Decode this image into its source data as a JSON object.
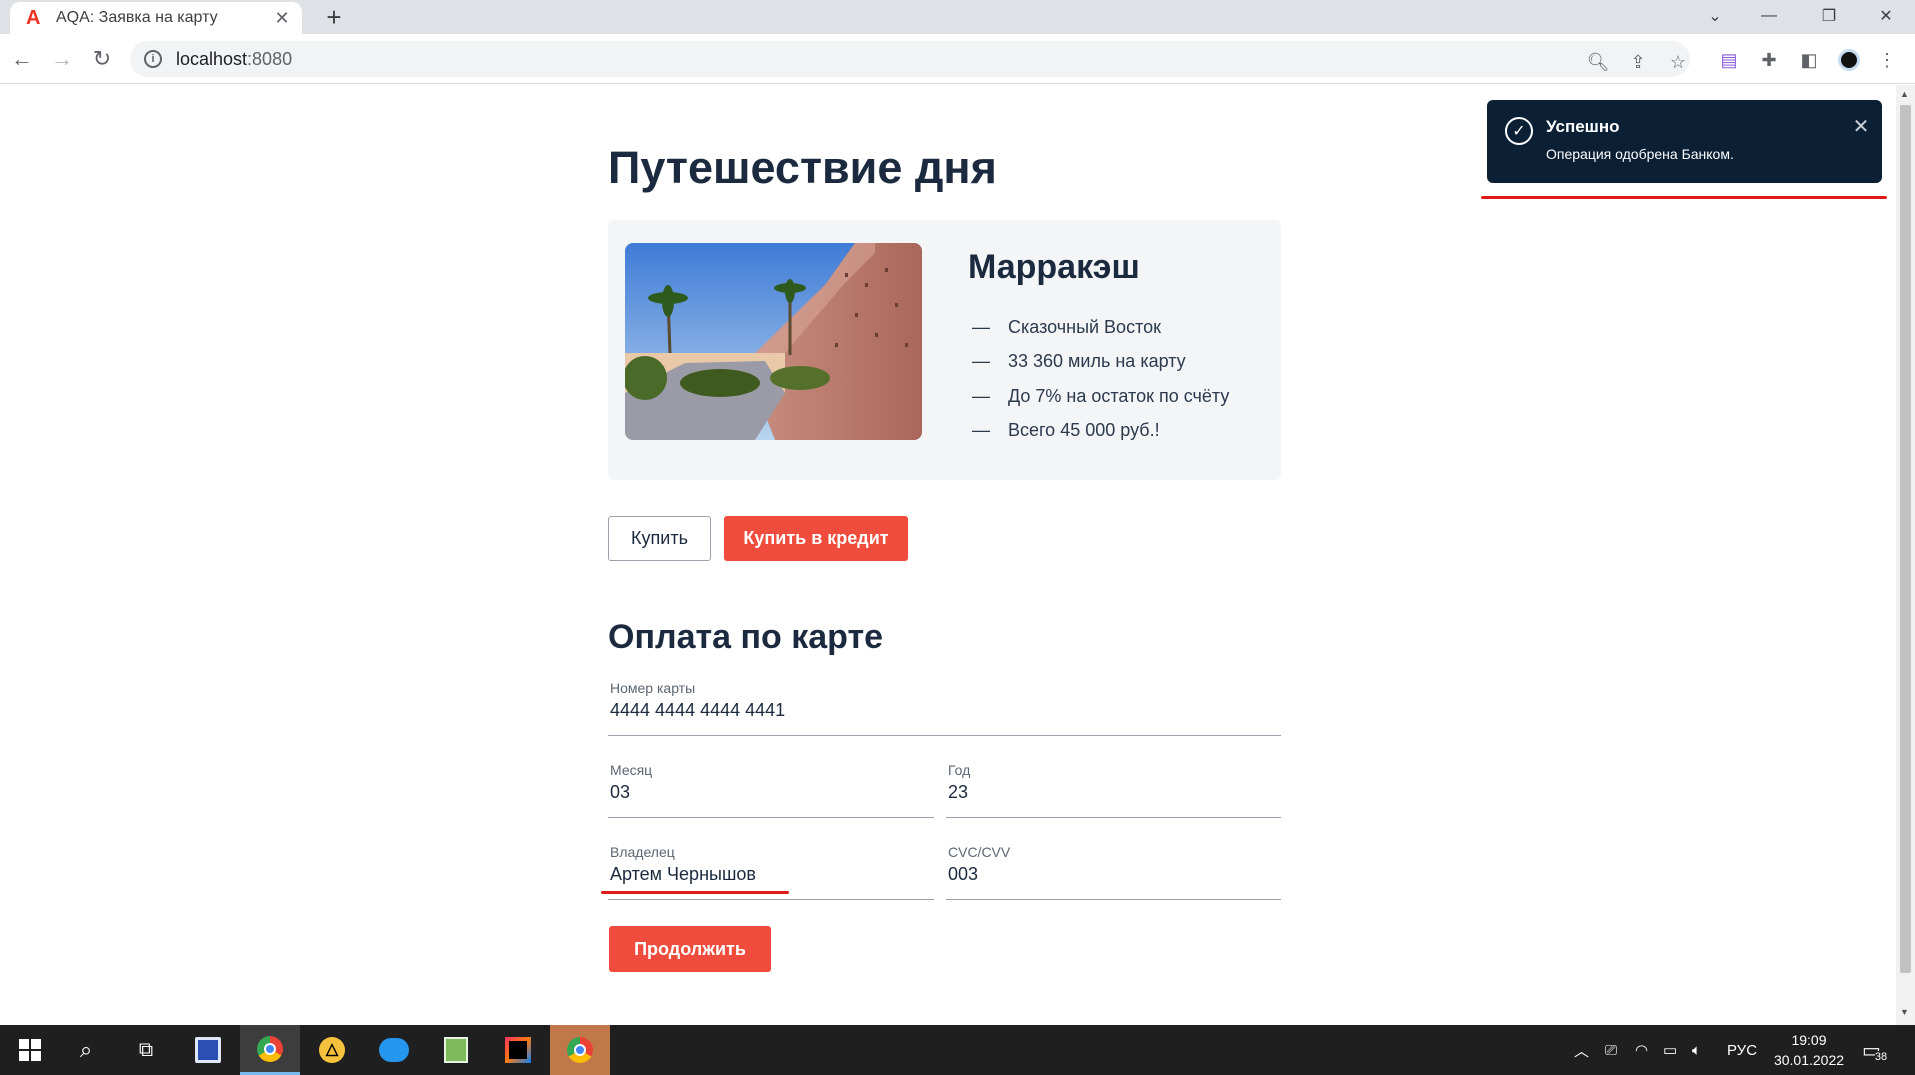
{
  "browser": {
    "tab_title": "AQA: Заявка на карту",
    "tab_favicon": "alfa-logo-icon",
    "url_host": "localhost",
    "url_port": ":8080"
  },
  "page": {
    "title": "Путешествие дня",
    "tour": {
      "city": "Марракэш",
      "features": [
        "Сказочный Восток",
        "33 360 миль на карту",
        "До 7% на остаток по счёту",
        "Всего 45 000 руб.!"
      ]
    },
    "buy_button": "Купить",
    "credit_button": "Купить в кредит",
    "payment": {
      "title": "Оплата по карте",
      "card_number": {
        "label": "Номер карты",
        "value": "4444 4444 4444 4441"
      },
      "month": {
        "label": "Месяц",
        "value": "03"
      },
      "year": {
        "label": "Год",
        "value": "23"
      },
      "owner": {
        "label": "Владелец",
        "value": "Артем Чернышов"
      },
      "cvc": {
        "label": "CVC/CVV",
        "value": "003"
      },
      "continue_button": "Продолжить"
    }
  },
  "notification": {
    "title": "Успешно",
    "message": "Операция одобрена Банком."
  },
  "taskbar": {
    "language": "РУС",
    "time": "19:09",
    "date": "30.01.2022",
    "notifications_count": "38"
  },
  "colors": {
    "accent": "#ef4c3e",
    "text": "#1b2a3f",
    "toast_bg": "#0b1f35",
    "annotation": "#e01a1a"
  }
}
